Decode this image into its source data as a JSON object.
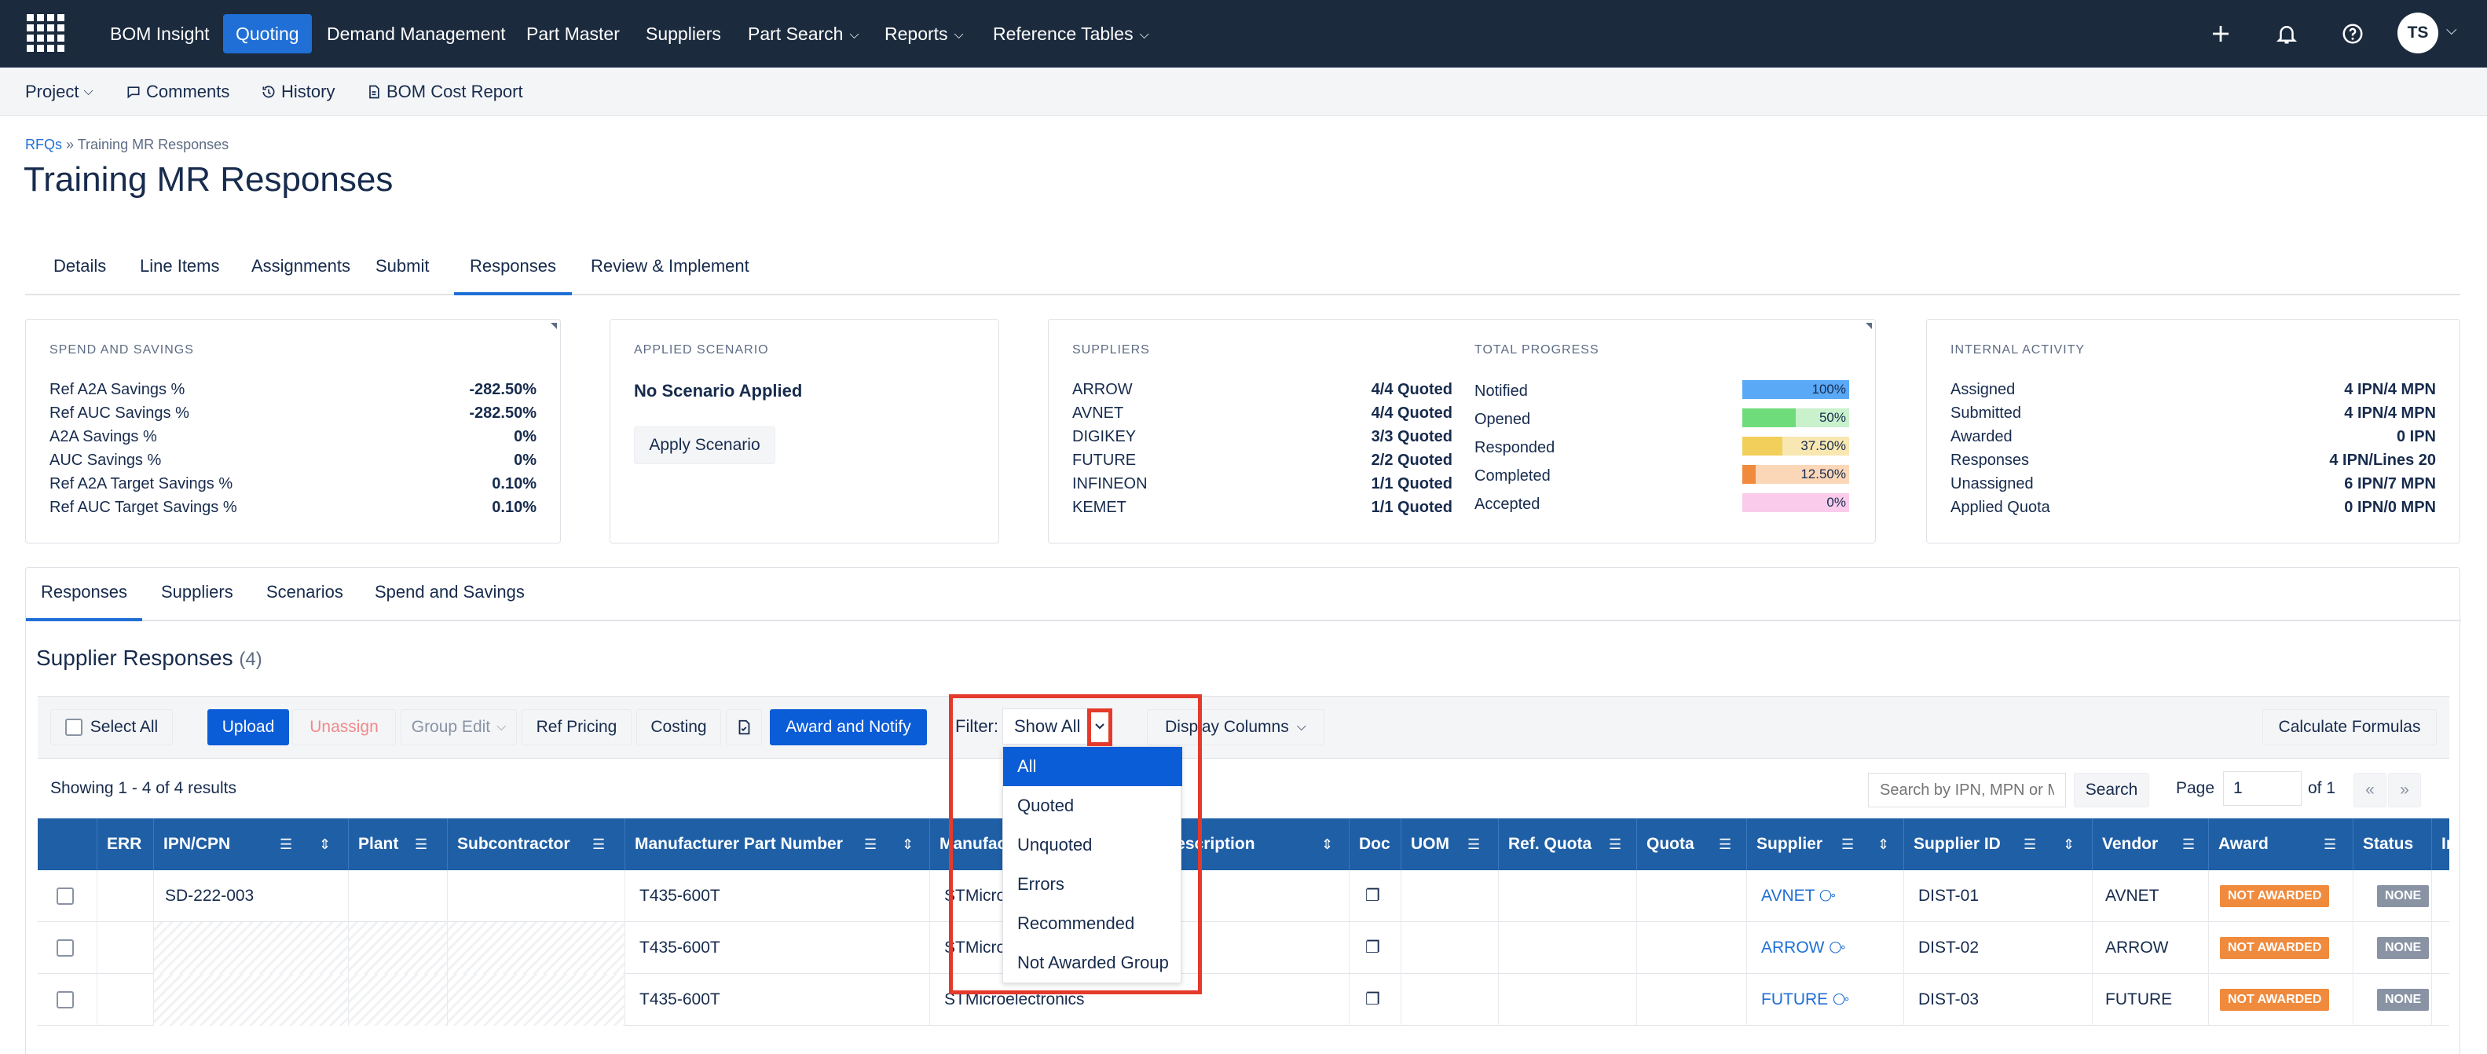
{
  "nav": {
    "items": [
      {
        "label": "BOM Insight",
        "dropdown": false
      },
      {
        "label": "Quoting",
        "dropdown": false,
        "active": true
      },
      {
        "label": "Demand Management",
        "dropdown": false
      },
      {
        "label": "Part Master",
        "dropdown": false
      },
      {
        "label": "Suppliers",
        "dropdown": false
      },
      {
        "label": "Part Search",
        "dropdown": true
      },
      {
        "label": "Reports",
        "dropdown": true
      },
      {
        "label": "Reference Tables",
        "dropdown": true
      }
    ],
    "avatar": "TS"
  },
  "subnav": {
    "project": "Project",
    "comments": "Comments",
    "history": "History",
    "bom_cost_report": "BOM Cost Report"
  },
  "breadcrumb": {
    "root": "RFQs",
    "sep": "»",
    "current": "Training MR Responses"
  },
  "page_title": "Training MR Responses",
  "tabs": [
    "Details",
    "Line Items",
    "Assignments",
    "Submit",
    "Responses",
    "Review & Implement"
  ],
  "spend": {
    "title": "SPEND AND SAVINGS",
    "rows": [
      {
        "label": "Ref A2A Savings %",
        "value": "-282.50%"
      },
      {
        "label": "Ref AUC Savings %",
        "value": "-282.50%"
      },
      {
        "label": "A2A Savings %",
        "value": "0%"
      },
      {
        "label": "AUC Savings %",
        "value": "0%"
      },
      {
        "label": "Ref A2A Target Savings %",
        "value": "0.10%"
      },
      {
        "label": "Ref AUC Target Savings %",
        "value": "0.10%"
      }
    ]
  },
  "scenario": {
    "title": "APPLIED SCENARIO",
    "status": "No Scenario Applied",
    "button": "Apply Scenario"
  },
  "suppliers": {
    "title": "SUPPLIERS",
    "rows": [
      {
        "label": "ARROW",
        "value": "4/4 Quoted"
      },
      {
        "label": "AVNET",
        "value": "4/4 Quoted"
      },
      {
        "label": "DIGIKEY",
        "value": "3/3 Quoted"
      },
      {
        "label": "FUTURE",
        "value": "2/2 Quoted"
      },
      {
        "label": "INFINEON",
        "value": "1/1 Quoted"
      },
      {
        "label": "KEMET",
        "value": "1/1 Quoted"
      }
    ]
  },
  "progress": {
    "title": "TOTAL PROGRESS",
    "rows": [
      {
        "label": "Notified",
        "value": "100%",
        "fraction": 1.0,
        "color": "#5aa9f7",
        "track": "#5aa9f7"
      },
      {
        "label": "Opened",
        "value": "50%",
        "fraction": 0.5,
        "color": "#6fdc7c",
        "track": "#c9f1cc"
      },
      {
        "label": "Responded",
        "value": "37.50%",
        "fraction": 0.375,
        "color": "#f2cf5b",
        "track": "#f8e7b0"
      },
      {
        "label": "Completed",
        "value": "12.50%",
        "fraction": 0.125,
        "color": "#f08a3c",
        "track": "#fbd7b8"
      },
      {
        "label": "Accepted",
        "value": "0%",
        "fraction": 0.0,
        "color": "#f6a5d9",
        "track": "#fbcbeb"
      }
    ]
  },
  "activity": {
    "title": "INTERNAL ACTIVITY",
    "rows": [
      {
        "label": "Assigned",
        "value": "4 IPN/4 MPN"
      },
      {
        "label": "Submitted",
        "value": "4 IPN/4 MPN"
      },
      {
        "label": "Awarded",
        "value": "0 IPN"
      },
      {
        "label": "Responses",
        "value": "4 IPN/Lines 20"
      },
      {
        "label": "Unassigned",
        "value": "6 IPN/7 MPN"
      },
      {
        "label": "Applied Quota",
        "value": "0 IPN/0 MPN"
      }
    ]
  },
  "panel_tabs": [
    "Responses",
    "Suppliers",
    "Scenarios",
    "Spend and Savings"
  ],
  "section": {
    "title": "Supplier Responses",
    "count": "(4)"
  },
  "toolbar": {
    "select_all": "Select All",
    "upload": "Upload",
    "unassign": "Unassign",
    "group_edit": "Group Edit",
    "ref_pricing": "Ref Pricing",
    "costing": "Costing",
    "award_notify": "Award and Notify",
    "filter_label": "Filter:",
    "filter_value": "Show All",
    "display_columns": "Display Columns",
    "calculate": "Calculate Formulas"
  },
  "results": {
    "showing": "Showing 1 - 4 of 4 results",
    "search_placeholder": "Search by IPN, MPN or M",
    "search_button": "Search",
    "page_label": "Page",
    "page_value": "1",
    "of_label": "of 1",
    "prev": "«",
    "next": "»"
  },
  "table": {
    "columns": [
      "ERR",
      "IPN/CPN",
      "Plant",
      "Subcontractor",
      "Manufacturer Part Number",
      "Manufacturer",
      "Description",
      "Doc",
      "UOM",
      "Ref. Quota",
      "Quota",
      "Supplier",
      "Supplier ID",
      "Vendor",
      "Award",
      "Status",
      "In"
    ],
    "rows": [
      {
        "ipn": "SD-222-003",
        "mpn": "T435-600T",
        "manufacturer": "STMicroelectronics",
        "supplier": "AVNET",
        "supplier_id": "DIST-01",
        "vendor": "AVNET",
        "award": "NOT AWARDED",
        "status": "NONE"
      },
      {
        "ipn": "",
        "mpn": "T435-600T",
        "manufacturer": "STMicroelectronics",
        "supplier": "ARROW",
        "supplier_id": "DIST-02",
        "vendor": "ARROW",
        "award": "NOT AWARDED",
        "status": "NONE"
      },
      {
        "ipn": "",
        "mpn": "T435-600T",
        "manufacturer": "STMicroelectronics",
        "supplier": "FUTURE",
        "supplier_id": "DIST-03",
        "vendor": "FUTURE",
        "award": "NOT AWARDED",
        "status": "NONE"
      }
    ]
  },
  "filter_menu": {
    "options": [
      "All",
      "Quoted",
      "Unquoted",
      "Errors",
      "Recommended",
      "Not Awarded Group"
    ],
    "selected": "All"
  }
}
